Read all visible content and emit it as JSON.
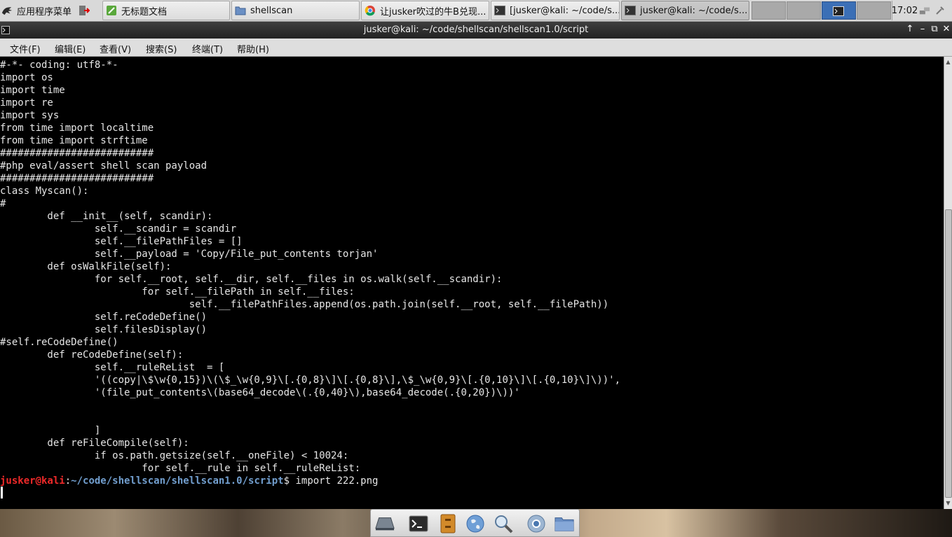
{
  "taskbar": {
    "app_menu_label": "应用程序菜单",
    "buttons": [
      {
        "label": "无标题文档",
        "icon": "text-editor-icon"
      },
      {
        "label": "shellscan",
        "icon": "folder-icon"
      },
      {
        "label": "让jusker吹过的牛B兑现...",
        "icon": "chrome-icon"
      },
      {
        "label": "[jusker@kali: ~/code/s...",
        "icon": "terminal-icon"
      },
      {
        "label": "jusker@kali: ~/code/s...",
        "icon": "terminal-icon"
      }
    ],
    "clock": "17:02"
  },
  "window": {
    "title": "jusker@kali: ~/code/shellscan/shellscan1.0/script",
    "controls": [
      "↑",
      "–",
      "⧉",
      "✕"
    ]
  },
  "menubar": [
    "文件(F)",
    "编辑(E)",
    "查看(V)",
    "搜索(S)",
    "终端(T)",
    "帮助(H)"
  ],
  "terminal": {
    "lines": [
      "#-*- coding: utf8-*-",
      "import os",
      "import time",
      "import re",
      "import sys",
      "from time import localtime",
      "from time import strftime",
      "##########################",
      "#php eval/assert shell scan payload",
      "##########################",
      "class Myscan():",
      "#",
      "        def __init__(self, scandir):",
      "                self.__scandir = scandir",
      "                self.__filePathFiles = []",
      "                self.__payload = 'Copy/File_put_contents torjan'",
      "        def osWalkFile(self):",
      "                for self.__root, self.__dir, self.__files in os.walk(self.__scandir):",
      "                        for self.__filePath in self.__files:",
      "                                self.__filePathFiles.append(os.path.join(self.__root, self.__filePath))",
      "                self.reCodeDefine()",
      "                self.filesDisplay()",
      "#self.reCodeDefine()",
      "        def reCodeDefine(self):",
      "                self.__ruleReList  = [",
      "                '((copy|\\$\\w{0,15})\\(\\$_\\w{0,9}\\[.{0,8}\\]\\[.{0,8}\\],\\$_\\w{0,9}\\[.{0,10}\\]\\[.{0,10}\\]\\))',",
      "                '(file_put_contents\\(base64_decode\\(.{0,40}\\),base64_decode(.{0,20})\\))'",
      "",
      "",
      "                ]",
      "        def reFileCompile(self):",
      "                if os.path.getsize(self.__oneFile) < 10024:",
      "                        for self.__rule in self.__ruleReList:"
    ],
    "prompt_user": "jusker@kali",
    "prompt_sep": ":",
    "prompt_path": "~/code/shellscan/shellscan1.0/script",
    "prompt_symbol": "$",
    "prompt_command": " import 222.png"
  },
  "dock": [
    "show-desktop-icon",
    "terminal-icon",
    "files-drawer-icon",
    "browser-globe-icon",
    "search-magnifier-icon",
    "chrome-icon",
    "folder-icon"
  ]
}
